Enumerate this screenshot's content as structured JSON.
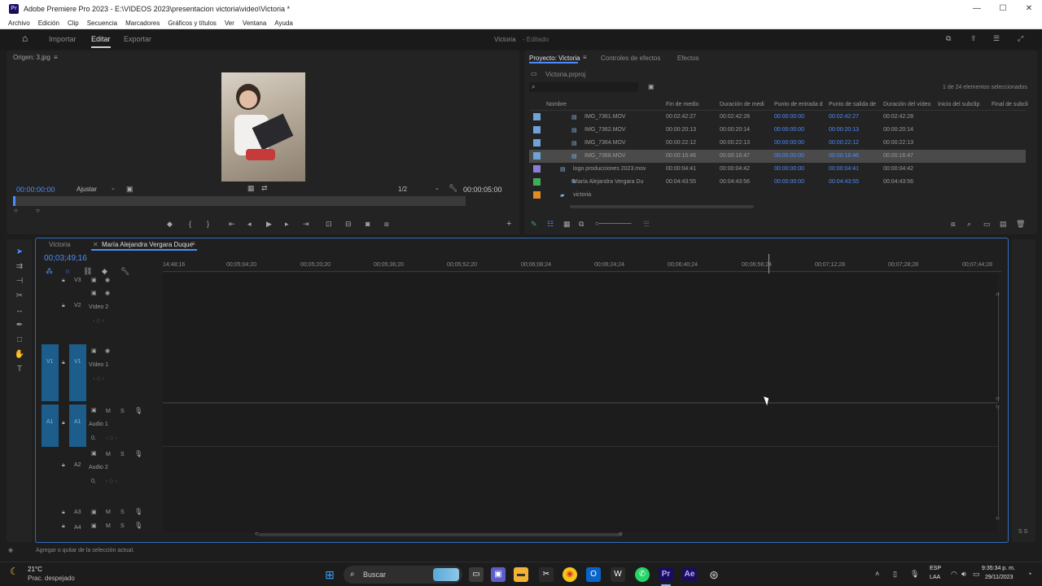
{
  "window": {
    "title": "Adobe Premiere Pro 2023 - E:\\VIDEOS 2023\\presentacion victoria\\video\\Victoria *",
    "app_icon": "Pr",
    "buttons": {
      "minimize": "—",
      "maximize": "☐",
      "close": "✕"
    }
  },
  "menu": [
    "Archivo",
    "Edición",
    "Clip",
    "Secuencia",
    "Marcadores",
    "Gráficos y títulos",
    "Ver",
    "Ventana",
    "Ayuda"
  ],
  "header": {
    "tabs": [
      "Importar",
      "Editar",
      "Exportar"
    ],
    "active_tab": "Editar",
    "project_name": "Victoria",
    "status": "- Editado"
  },
  "source_monitor": {
    "title": "Origen: 3.jpg",
    "timecode_in": "00:00:00:00",
    "fit": "Ajustar",
    "resolution": "1/2",
    "timecode_out": "00:00:05:00"
  },
  "project_panel": {
    "tabs": [
      "Proyecto: Victoria",
      "Controles de efectos",
      "Efectos"
    ],
    "file": "Victoria.prproj",
    "selection_info": "1 de 24 elementos seleccionados",
    "columns": [
      "Nombre",
      "Fin de medio",
      "Duración de medi",
      "Punto de entrada d",
      "Punto de salida de",
      "Duración del vídeo",
      "Inicio del subclip",
      "Final de subcli"
    ],
    "rows": [
      {
        "name": "IMG_7361.MOV",
        "fin": "00:02:42:27",
        "dur": "00:02:42:28",
        "in": "00:00:00:00",
        "out": "00:02:42:27",
        "vdur": "00:02:42:28",
        "color": "#6fa3d8",
        "selected": false
      },
      {
        "name": "IMG_7362.MOV",
        "fin": "00:00:20:13",
        "dur": "00:00:20:14",
        "in": "00:00:00:00",
        "out": "00:00:20:13",
        "vdur": "00:00:20:14",
        "color": "#6fa3d8",
        "selected": false
      },
      {
        "name": "IMG_7364.MOV",
        "fin": "00:00:22:12",
        "dur": "00:00:22:13",
        "in": "00:00:00:00",
        "out": "00:00:22:12",
        "vdur": "00:00:22:13",
        "color": "#6fa3d8",
        "selected": false
      },
      {
        "name": "IMG_7368.MOV",
        "fin": "00:00:16:46",
        "dur": "00:00:16:47",
        "in": "00:00:00:00",
        "out": "00:00:16:46",
        "vdur": "00:00:16:47",
        "color": "#6fa3d8",
        "selected": true
      },
      {
        "name": "logo producciones 2023.mov",
        "fin": "00:00:04:41",
        "dur": "00:00:04:42",
        "in": "00:00:00:00",
        "out": "00:00:04:41",
        "vdur": "00:00:04:42",
        "color": "#8a7fd8",
        "selected": false
      },
      {
        "name": "María Alejandra Vergara Du",
        "fin": "00:04:43:55",
        "dur": "00:04:43:56",
        "in": "00:00:00:00",
        "out": "00:04:43:55",
        "vdur": "00:04:43:56",
        "color": "#3fae5a",
        "selected": false
      },
      {
        "name": "victoria",
        "fin": "",
        "dur": "",
        "in": "",
        "out": "",
        "vdur": "",
        "color": "#e38a23",
        "selected": false
      }
    ]
  },
  "timeline": {
    "tabs": [
      "Victoria",
      "María Alejandra Vergara Duque"
    ],
    "timecode": "00;03;49;16",
    "ruler": [
      "14;48;16",
      "00;05;04;20",
      "00;05;20;20",
      "00;05;36;20",
      "00;05;52;20",
      "00;06;08;24",
      "00;06;24;24",
      "00;06;40;24",
      "00;06;56;24",
      "00;07;12;28",
      "00;07;28;28",
      "00;07;44;28"
    ],
    "tracks": {
      "v3": "V3",
      "v2": "V2",
      "v2_name": "Vídeo 2",
      "v1": "V1",
      "v1_name": "Vídeo 1",
      "a1": "A1",
      "a1_name": "Audio 1",
      "a1_vol": "0,",
      "a2": "A2",
      "a2_name": "Audio 2",
      "a2_vol": "0,",
      "a3": "A3",
      "a4": "A4",
      "mute": "M",
      "solo": "S"
    }
  },
  "status_bar": "Agregar o quitar de la selección actual.",
  "taskbar": {
    "weather_temp": "21°C",
    "weather_desc": "Prac. despejado",
    "search": "Buscar",
    "lang": "ESP",
    "lang2": "LAA",
    "time": "9:35:34 p. m.",
    "date": "29/11/2023"
  }
}
